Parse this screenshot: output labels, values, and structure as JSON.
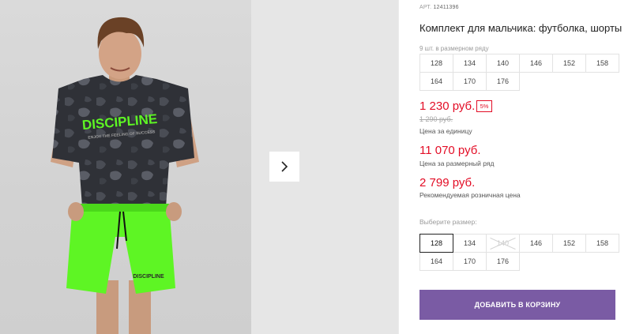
{
  "product": {
    "article_label": "АРТ.",
    "article_code": "12411396",
    "title": "Комплект для мальчика: футболка, шорты",
    "row_count_text": "9 шт. в размерном ряду",
    "row_sizes": [
      "128",
      "134",
      "140",
      "146",
      "152",
      "158",
      "164",
      "170",
      "176"
    ],
    "prices": {
      "current": "1 230 руб.",
      "discount_badge": "5%",
      "old": "1 290 руб.",
      "unit_caption": "Цена за единицу",
      "row_price": "11 070 руб.",
      "row_caption": "Цена за размерный ряд",
      "rrp": "2 799 руб.",
      "rrp_caption": "Рекомендуемая розничная цена"
    },
    "select_size_label": "Выберите размер:",
    "size_options": [
      {
        "label": "128",
        "selected": true,
        "available": true
      },
      {
        "label": "134",
        "selected": false,
        "available": true
      },
      {
        "label": "140",
        "selected": false,
        "available": false
      },
      {
        "label": "146",
        "selected": false,
        "available": true
      },
      {
        "label": "152",
        "selected": false,
        "available": true
      },
      {
        "label": "158",
        "selected": false,
        "available": true
      },
      {
        "label": "164",
        "selected": false,
        "available": true
      },
      {
        "label": "170",
        "selected": false,
        "available": true
      },
      {
        "label": "176",
        "selected": false,
        "available": true
      }
    ],
    "add_to_cart_label": "ДОБАВИТЬ В КОРЗИНУ",
    "shirt_print_title": "DISCIPLINE",
    "shirt_print_sub": "ENJOY THE FEELING OF SUCCESS",
    "shorts_print": "DISCIPLINE"
  },
  "gallery": {
    "next_icon": "chevron-right-icon"
  },
  "colors": {
    "price_red": "#e30d26",
    "button_purple": "#7a5ba4",
    "shirt": "#2f3137",
    "shorts_green": "#5ef524"
  }
}
